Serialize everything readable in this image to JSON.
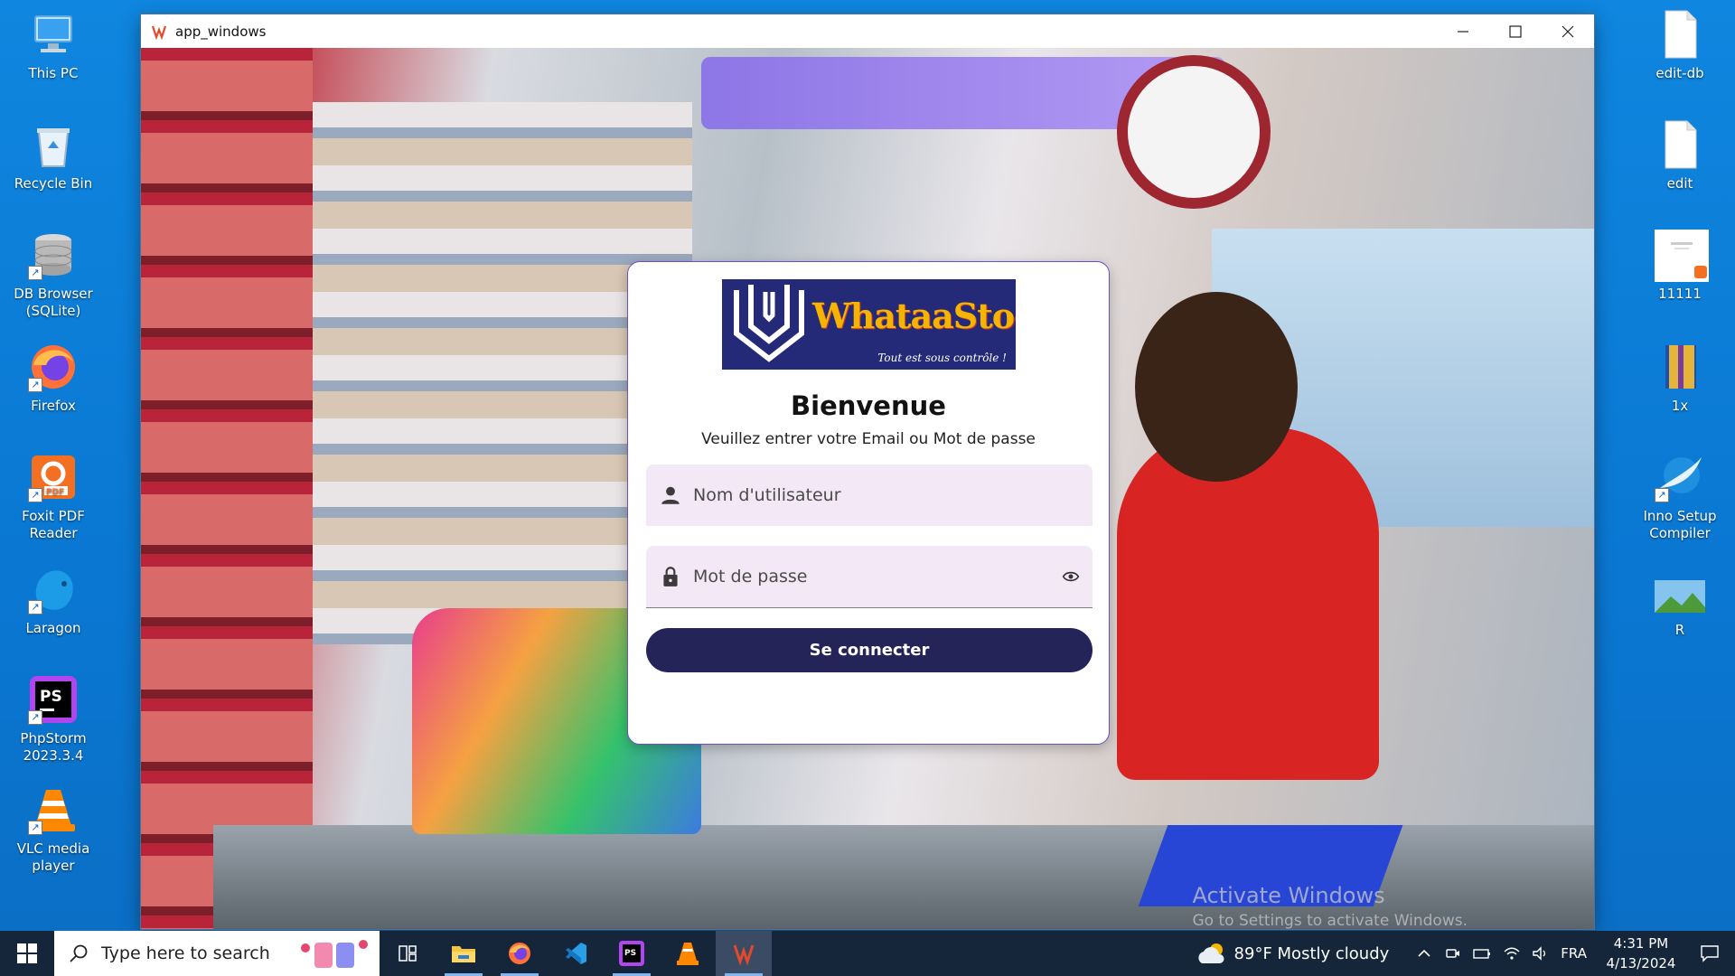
{
  "desktop": {
    "left_icons": [
      {
        "label": "This PC",
        "icon": "computer-icon"
      },
      {
        "label": "Recycle Bin",
        "icon": "recycle-bin-icon"
      },
      {
        "label": "DB Browser (SQLite)",
        "icon": "database-icon"
      },
      {
        "label": "Firefox",
        "icon": "firefox-icon"
      },
      {
        "label": "Foxit PDF Reader",
        "icon": "pdf-icon"
      },
      {
        "label": "Laragon",
        "icon": "laragon-icon"
      },
      {
        "label": "PhpStorm 2023.3.4",
        "icon": "phpstorm-icon"
      },
      {
        "label": "VLC media player",
        "icon": "vlc-icon"
      }
    ],
    "right_icons": [
      {
        "label": "edit-db",
        "icon": "file-icon"
      },
      {
        "label": "edit",
        "icon": "file-icon"
      },
      {
        "label": "11111",
        "icon": "pdf-document-icon"
      },
      {
        "label": "1x",
        "icon": "archive-icon"
      },
      {
        "label": "Inno Setup Compiler",
        "icon": "inno-setup-icon"
      },
      {
        "label": "R",
        "icon": "image-icon"
      }
    ]
  },
  "window": {
    "title": "app_windows",
    "controls": {
      "minimize": "minimize-icon",
      "maximize": "maximize-icon",
      "close": "close-icon"
    }
  },
  "login": {
    "logo": {
      "name": "WhataaStock",
      "tagline": "Tout est sous contrôle !"
    },
    "heading": "Bienvenue",
    "subtitle": "Veuillez entrer votre Email ou Mot de passe",
    "username_placeholder": "Nom d'utilisateur",
    "password_placeholder": "Mot de passe",
    "submit_label": "Se connecter"
  },
  "watermark": {
    "line1": "Activate Windows",
    "line2": "Go to Settings to activate Windows."
  },
  "taskbar": {
    "search_placeholder": "Type here to search",
    "apps": [
      "task-view-icon",
      "file-explorer-icon",
      "firefox-icon",
      "vscode-icon",
      "phpstorm-icon",
      "vlc-icon",
      "app-windows-icon"
    ],
    "weather": "89°F  Mostly cloudy",
    "language": "FRA",
    "time": "4:31 PM",
    "date": "4/13/2024"
  },
  "colors": {
    "desktop": "#0a78d3",
    "taskbar": "#15263b",
    "button": "#252458",
    "field": "#f3e8f6",
    "logo_bg": "#252a78",
    "logo_text": "#f5b400"
  }
}
